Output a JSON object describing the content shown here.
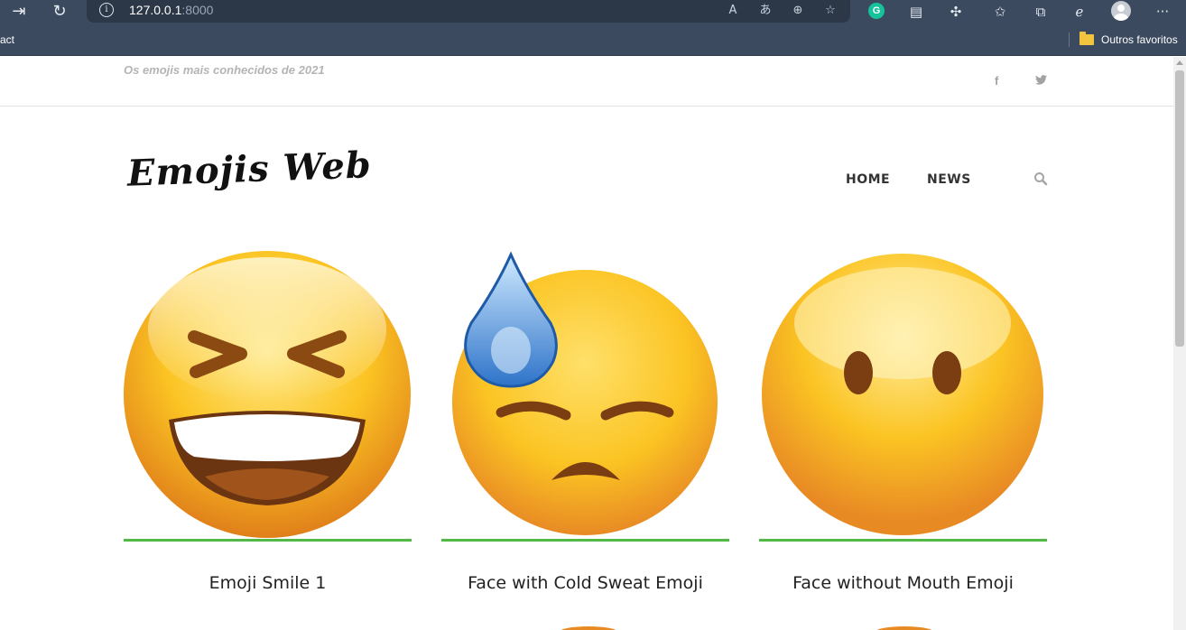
{
  "browser": {
    "url_host": "127.0.0.1",
    "url_port": ":8000",
    "favorites_left_label": "act",
    "favorites_folder_label": "Outros favoritos",
    "grammarly_letter": "G",
    "more_label": "···"
  },
  "header": {
    "tagline": "Os emojis mais conhecidos de 2021",
    "social": [
      "f",
      "t"
    ]
  },
  "site": {
    "logo": "Emojis Web",
    "menu": [
      "HOME",
      "NEWS"
    ]
  },
  "cards": [
    {
      "title": "Emoji Smile 1",
      "icon": "laughing-emoji-icon"
    },
    {
      "title": "Face with Cold Sweat Emoji",
      "icon": "cold-sweat-emoji-icon"
    },
    {
      "title": "Face without Mouth Emoji",
      "icon": "no-mouth-emoji-icon"
    }
  ],
  "colors": {
    "accent_line": "#52b846",
    "emoji_yellow": "#fbc423",
    "emoji_orange": "#e88a24",
    "chrome": "#3b4a5e"
  }
}
